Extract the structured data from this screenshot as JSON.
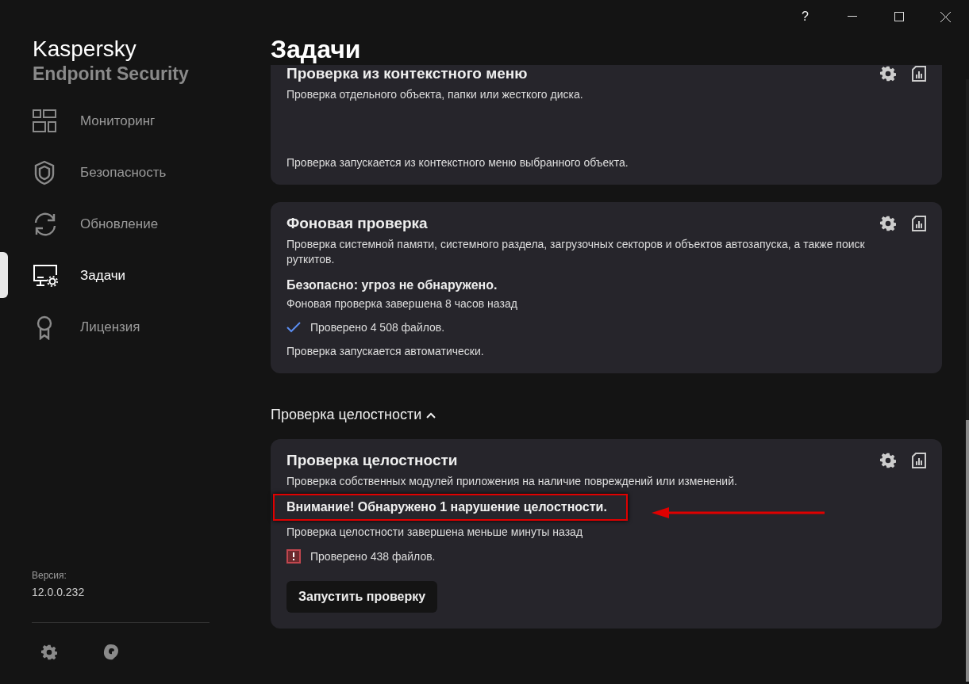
{
  "window": {
    "help": "?"
  },
  "sidebar": {
    "brand": "Kaspersky",
    "product": "Endpoint Security",
    "items": [
      {
        "label": "Мониторинг",
        "selected": false
      },
      {
        "label": "Безопасность",
        "selected": false
      },
      {
        "label": "Обновление",
        "selected": false
      },
      {
        "label": "Задачи",
        "selected": true
      },
      {
        "label": "Лицензия",
        "selected": false
      }
    ],
    "version_label": "Версия:",
    "version": "12.0.0.232"
  },
  "page_title": "Задачи",
  "sections": [
    {
      "cards": [
        {
          "title": "Проверка из контекстного меню",
          "description": "Проверка отдельного объекта, папки или жесткого диска.",
          "footer": "Проверка запускается из контекстного меню выбранного объекта."
        },
        {
          "title": "Фоновая проверка",
          "description": "Проверка системной памяти, системного раздела, загрузочных секторов и объектов автозапуска, а также поиск руткитов.",
          "status": {
            "heading": "Безопасно: угроз не обнаружено.",
            "highlighted": false,
            "time": "Фоновая проверка завершена 8 часов назад",
            "result": {
              "kind": "ok",
              "text": "Проверено 4 508 файлов."
            }
          },
          "footer": "Проверка запускается автоматически."
        }
      ]
    },
    {
      "header": {
        "title": "Проверка целостности",
        "expanded": true
      },
      "cards": [
        {
          "title": "Проверка целостности",
          "description": "Проверка собственных модулей приложения на наличие повреждений или изменений.",
          "status": {
            "heading": "Внимание! Обнаружено 1 нарушение целостности.",
            "highlighted": true,
            "time": "Проверка целостности завершена меньше минуты назад",
            "result": {
              "kind": "error",
              "text": "Проверено 438 файлов."
            }
          },
          "button": "Запустить проверку"
        }
      ]
    }
  ]
}
